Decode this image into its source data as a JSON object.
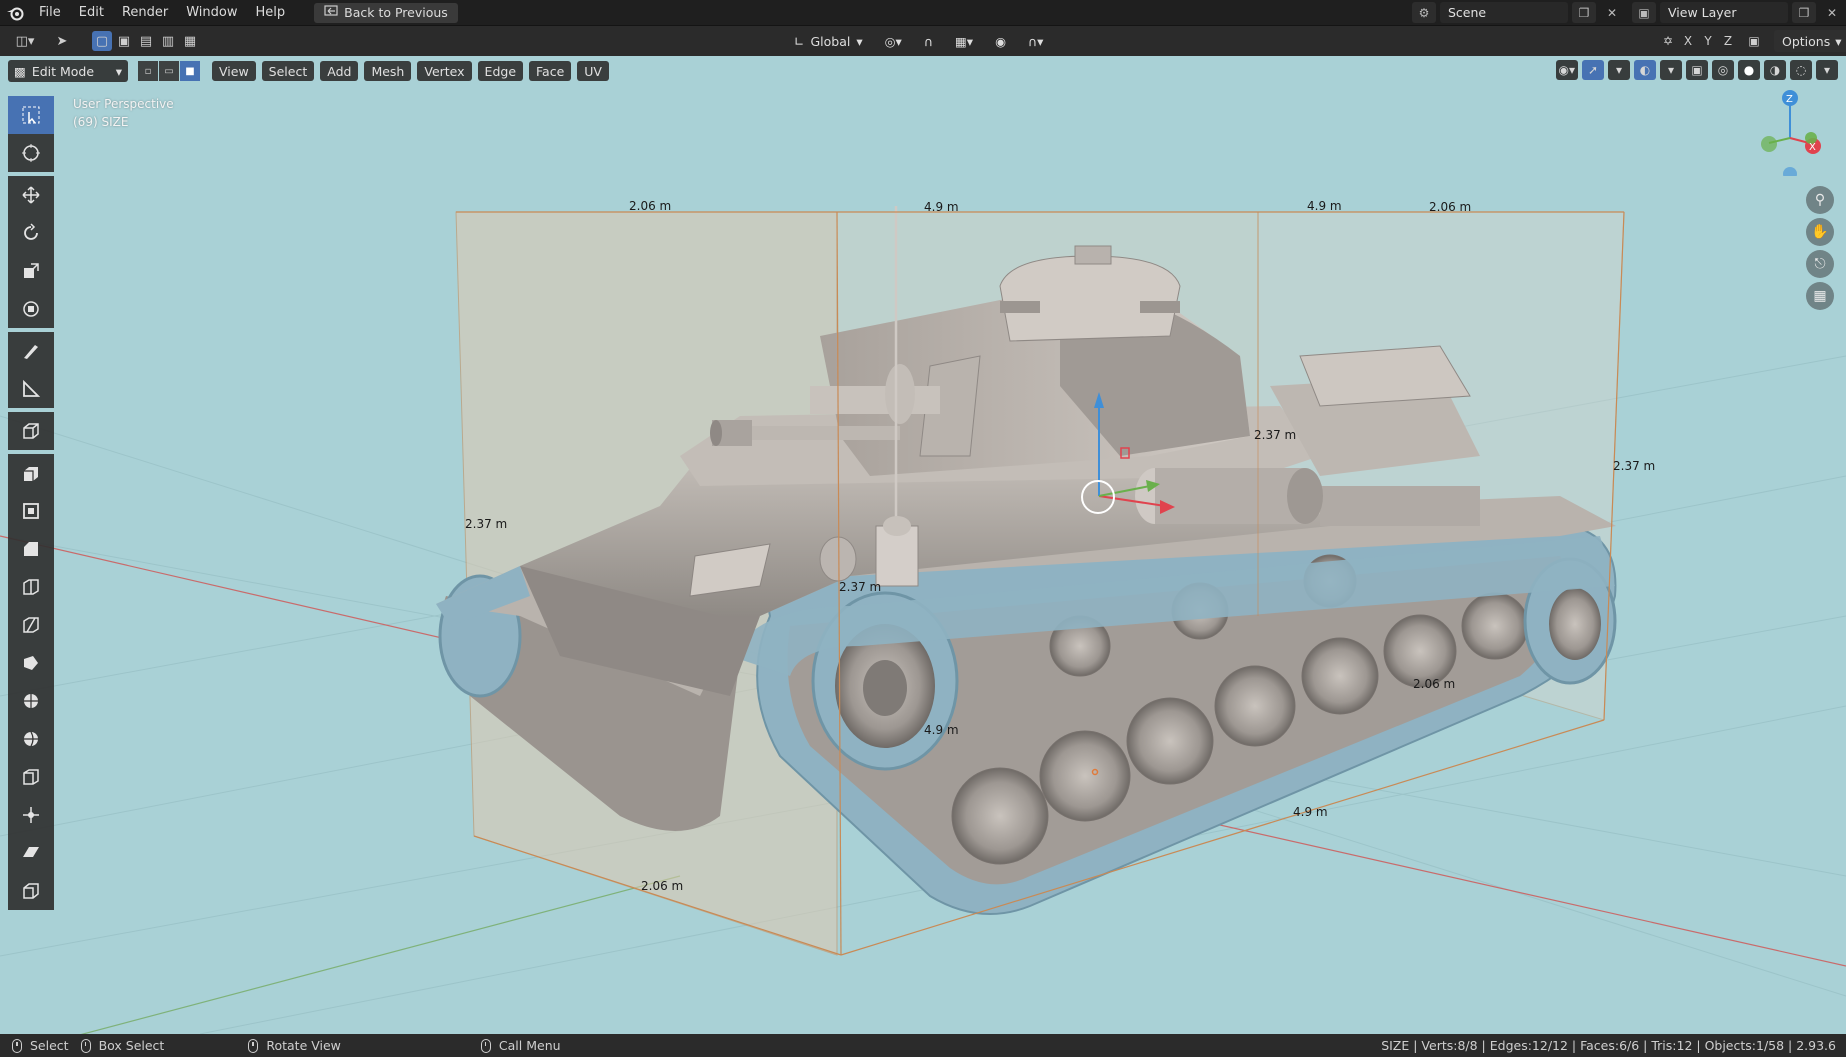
{
  "topbar": {
    "menu": [
      "File",
      "Edit",
      "Render",
      "Window",
      "Help"
    ],
    "back_button": "Back to Previous",
    "scene_field": "Scene",
    "view_layer_field": "View Layer"
  },
  "toolheader": {
    "orientation": "Global",
    "axes": [
      "X",
      "Y",
      "Z"
    ],
    "options_label": "Options"
  },
  "viewport": {
    "mode": "Edit Mode",
    "menus": [
      "View",
      "Select",
      "Add",
      "Mesh",
      "Vertex",
      "Edge",
      "Face",
      "UV"
    ],
    "perspective_label": "User Perspective",
    "object_label": "(69) SIZE",
    "background_color": "#a9d1d6",
    "measurements": {
      "top_width_left": "2.06 m",
      "top_length_left": "4.9 m",
      "top_length_right": "4.9 m",
      "top_width_right": "2.06 m",
      "height_mid": "2.37 m",
      "height_right": "2.37 m",
      "height_left": "2.37 m",
      "height_center": "2.37 m",
      "width_right_lower": "2.06 m",
      "length_mid_lower": "4.9 m",
      "length_bottom": "4.9 m",
      "width_bottom": "2.06 m"
    },
    "gizmo_axes": {
      "z": "Z",
      "x": "X"
    }
  },
  "tools": [
    "select-box-icon",
    "cursor-icon",
    "move-icon",
    "rotate-icon",
    "scale-icon",
    "transform-icon",
    "annotate-icon",
    "measure-icon",
    "add-cube-icon",
    "extrude-icon",
    "inset-icon",
    "bevel-icon",
    "loop-cut-icon",
    "knife-icon",
    "poly-build-icon",
    "spin-icon",
    "smooth-icon",
    "edge-slide-icon",
    "shrink-fatten-icon",
    "shear-icon",
    "rip-icon"
  ],
  "statusbar": {
    "select": "Select",
    "box_select": "Box Select",
    "rotate_view": "Rotate View",
    "call_menu": "Call Menu",
    "stats": "SIZE | Verts:8/8 | Edges:12/12 | Faces:6/6 | Tris:12 | Objects:1/58 | 2.93.6"
  },
  "colors": {
    "accent": "#4772b3",
    "bbox_edge": "#c98a55",
    "track_blue": "#8fb2c2",
    "gizmo_x": "#e0434e",
    "gizmo_y": "#6ab04c",
    "gizmo_z": "#3f8fd8"
  }
}
